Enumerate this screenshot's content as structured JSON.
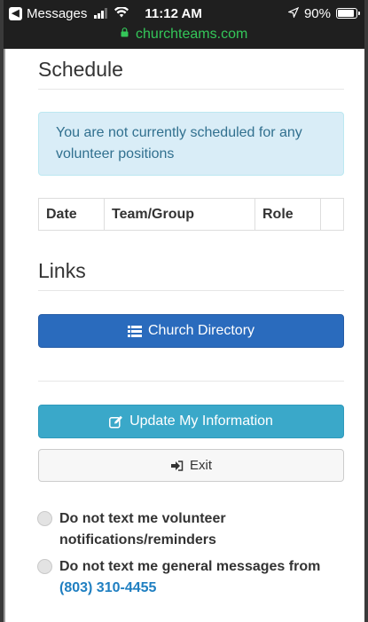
{
  "status_bar": {
    "back_app": "Messages",
    "time": "11:12 AM",
    "battery": "90%",
    "battery_level": 0.9
  },
  "browser": {
    "url": "churchteams.com"
  },
  "schedule": {
    "title": "Schedule",
    "notice": "You are not currently scheduled for any volunteer positions",
    "columns": [
      "Date",
      "Team/Group",
      "Role",
      ""
    ]
  },
  "links": {
    "title": "Links",
    "church_directory": "Church Directory",
    "update_info": "Update My Information",
    "exit": "Exit"
  },
  "options": [
    {
      "label": "Do not text me volunteer notifications/reminders",
      "checked": false
    },
    {
      "label": "Do not text me general messages from",
      "phone": "(803) 310-4455",
      "checked": false
    }
  ],
  "colors": {
    "primary": "#2a6bbd",
    "info": "#3aa8c9",
    "alert_bg": "#d9edf7",
    "alert_text": "#31708f",
    "url_green": "#34c759",
    "link_blue": "#1f7fc1"
  }
}
